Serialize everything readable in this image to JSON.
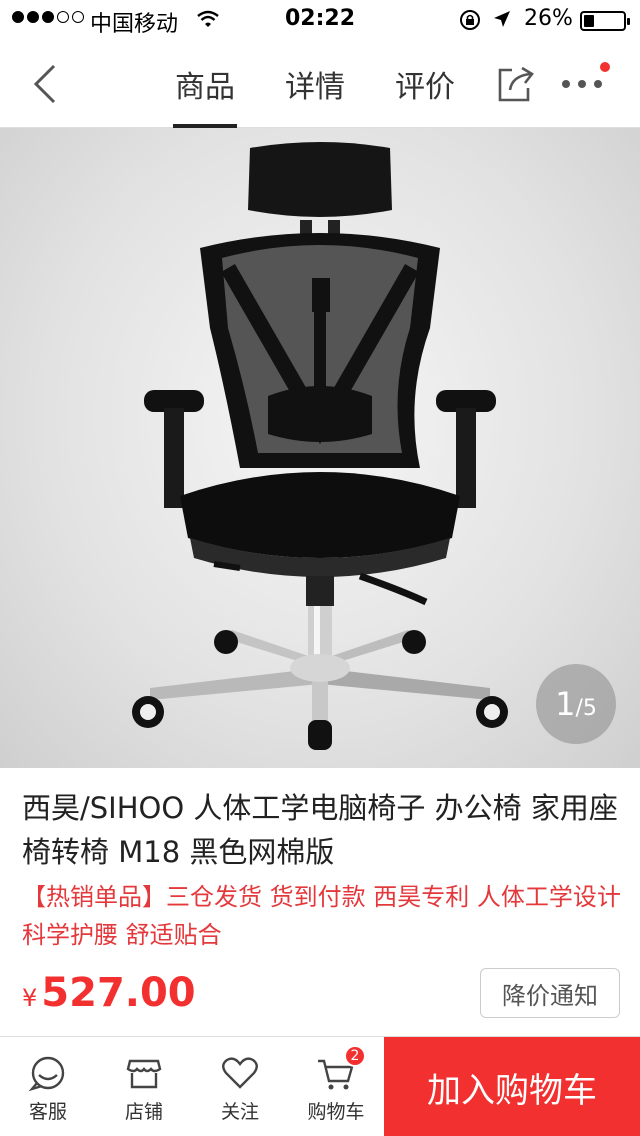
{
  "status_bar": {
    "carrier": "中国移动",
    "time": "02:22",
    "battery_percent": "26%",
    "battery_level": 0.26
  },
  "nav": {
    "tabs": [
      {
        "label": "商品",
        "active": true
      },
      {
        "label": "详情",
        "active": false
      },
      {
        "label": "评价",
        "active": false
      }
    ]
  },
  "gallery": {
    "current_page": "1",
    "separator": "/",
    "total_pages": "5"
  },
  "product": {
    "title": "西昊/SIHOO 人体工学电脑椅子 办公椅 家用座椅转椅 M18 黑色网棉版",
    "promo": "【热销单品】三仓发货 货到付款 西昊专利 人体工学设计 科学护腰 舒适贴合",
    "currency_symbol": "¥",
    "price": "527.00",
    "price_notify_label": "降价通知"
  },
  "bottom_bar": {
    "customer_service_label": "客服",
    "store_label": "店铺",
    "follow_label": "关注",
    "cart_label": "购物车",
    "cart_count": "2",
    "add_to_cart_label": "加入购物车"
  },
  "colors": {
    "accent": "#f23030",
    "promo_text": "#e4393c"
  }
}
